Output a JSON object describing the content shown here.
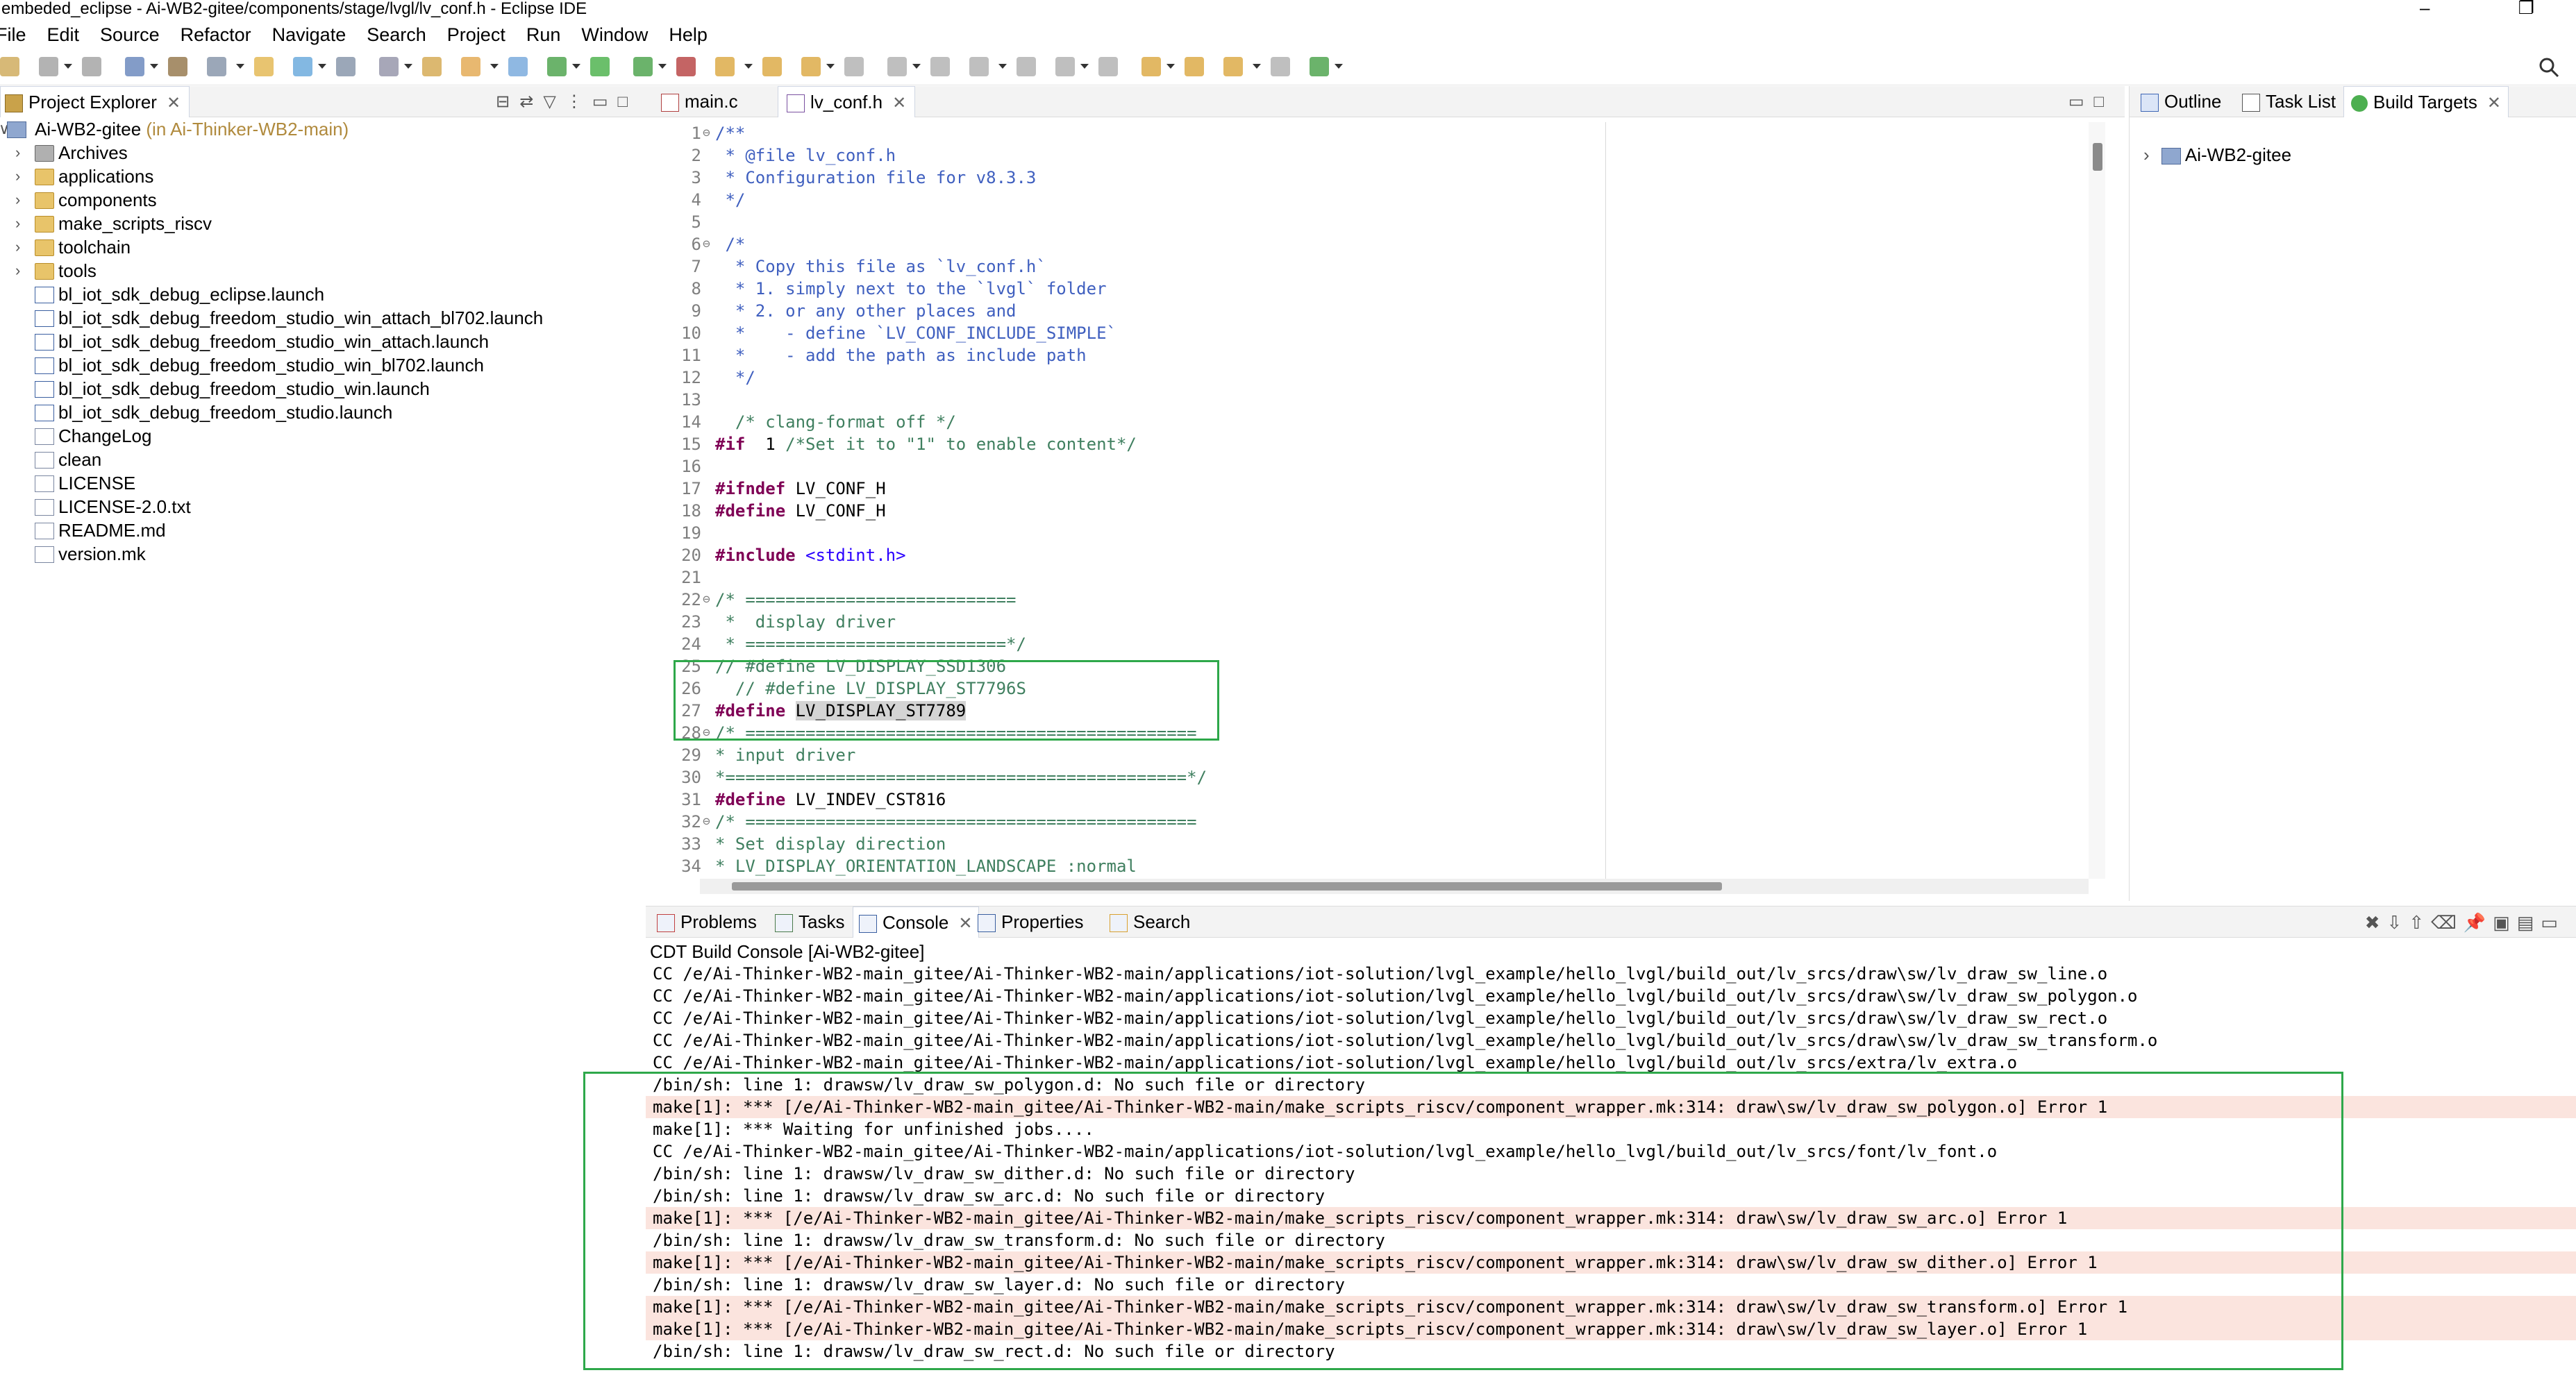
{
  "window": {
    "title": "embeded_eclipse - Ai-WB2-gitee/components/stage/lvgl/lv_conf.h - Eclipse IDE",
    "controls": "–  ❐"
  },
  "menu": [
    "File",
    "Edit",
    "Source",
    "Refactor",
    "Navigate",
    "Search",
    "Project",
    "Run",
    "Window",
    "Help"
  ],
  "explorer": {
    "tab_label": "Project Explorer",
    "root": {
      "name": "Ai-WB2-gitee",
      "suffix": " (in Ai-Thinker-WB2-main)"
    },
    "items": [
      {
        "label": "Archives",
        "kind": "archive",
        "expandable": true
      },
      {
        "label": "applications",
        "kind": "folder",
        "expandable": true
      },
      {
        "label": "components",
        "kind": "folder",
        "expandable": true
      },
      {
        "label": "make_scripts_riscv",
        "kind": "folder",
        "expandable": true
      },
      {
        "label": "toolchain",
        "kind": "folder",
        "expandable": true
      },
      {
        "label": "tools",
        "kind": "folder",
        "expandable": true
      },
      {
        "label": "bl_iot_sdk_debug_eclipse.launch",
        "kind": "launch",
        "expandable": false
      },
      {
        "label": "bl_iot_sdk_debug_freedom_studio_win_attach_bl702.launch",
        "kind": "launch",
        "expandable": false
      },
      {
        "label": "bl_iot_sdk_debug_freedom_studio_win_attach.launch",
        "kind": "launch",
        "expandable": false
      },
      {
        "label": "bl_iot_sdk_debug_freedom_studio_win_bl702.launch",
        "kind": "launch",
        "expandable": false
      },
      {
        "label": "bl_iot_sdk_debug_freedom_studio_win.launch",
        "kind": "launch",
        "expandable": false
      },
      {
        "label": "bl_iot_sdk_debug_freedom_studio.launch",
        "kind": "launch",
        "expandable": false
      },
      {
        "label": "ChangeLog",
        "kind": "file",
        "expandable": false
      },
      {
        "label": "clean",
        "kind": "file",
        "expandable": false
      },
      {
        "label": "LICENSE",
        "kind": "file",
        "expandable": false
      },
      {
        "label": "LICENSE-2.0.txt",
        "kind": "file",
        "expandable": false
      },
      {
        "label": "README.md",
        "kind": "file",
        "expandable": false
      },
      {
        "label": "version.mk",
        "kind": "file",
        "expandable": false
      }
    ]
  },
  "editor": {
    "tabs": [
      {
        "label": "main.c",
        "active": false
      },
      {
        "label": "lv_conf.h",
        "active": true
      }
    ],
    "lines": [
      {
        "n": "1",
        "fold": "⊖",
        "segs": [
          [
            "c-com",
            "/**"
          ]
        ]
      },
      {
        "n": "2",
        "segs": [
          [
            "c-com",
            " * @file lv_conf.h"
          ]
        ]
      },
      {
        "n": "3",
        "segs": [
          [
            "c-com",
            " * Configuration file for v8.3.3"
          ]
        ]
      },
      {
        "n": "4",
        "segs": [
          [
            "c-com",
            " */"
          ]
        ]
      },
      {
        "n": "5",
        "segs": []
      },
      {
        "n": "6",
        "fold": "⊖",
        "segs": [
          [
            "c-com",
            " /*"
          ]
        ]
      },
      {
        "n": "7",
        "segs": [
          [
            "c-com",
            "  * Copy this file as `lv_conf.h`"
          ]
        ]
      },
      {
        "n": "8",
        "segs": [
          [
            "c-com",
            "  * 1. simply next to the `lvgl` folder"
          ]
        ]
      },
      {
        "n": "9",
        "segs": [
          [
            "c-com",
            "  * 2. or any other places and"
          ]
        ]
      },
      {
        "n": "10",
        "segs": [
          [
            "c-com",
            "  *    - define `LV_CONF_INCLUDE_SIMPLE`"
          ]
        ]
      },
      {
        "n": "11",
        "segs": [
          [
            "c-com",
            "  *    - add the path as include path"
          ]
        ]
      },
      {
        "n": "12",
        "segs": [
          [
            "c-com",
            "  */"
          ]
        ]
      },
      {
        "n": "13",
        "segs": []
      },
      {
        "n": "14",
        "segs": [
          [
            "c-grn",
            "  /* clang-format off */"
          ]
        ]
      },
      {
        "n": "15",
        "segs": [
          [
            "c-kw",
            "#if"
          ],
          [
            "",
            "  1 "
          ],
          [
            "c-grn",
            "/*Set it to \"1\" to enable content*/"
          ]
        ]
      },
      {
        "n": "16",
        "segs": []
      },
      {
        "n": "17",
        "segs": [
          [
            "c-kw",
            "#ifndef"
          ],
          [
            "",
            " LV_CONF_H"
          ]
        ]
      },
      {
        "n": "18",
        "segs": [
          [
            "c-kw",
            "#define"
          ],
          [
            "",
            " LV_CONF_H"
          ]
        ]
      },
      {
        "n": "19",
        "segs": []
      },
      {
        "n": "20",
        "segs": [
          [
            "c-kw",
            "#include"
          ],
          [
            "",
            " "
          ],
          [
            "c-str",
            "<stdint.h>"
          ]
        ]
      },
      {
        "n": "21",
        "segs": []
      },
      {
        "n": "22",
        "fold": "⊖",
        "segs": [
          [
            "c-grn",
            "/* ==========================="
          ]
        ]
      },
      {
        "n": "23",
        "segs": [
          [
            "c-grn",
            " *  display driver"
          ]
        ]
      },
      {
        "n": "24",
        "segs": [
          [
            "c-grn",
            " * ==========================*/"
          ]
        ]
      },
      {
        "n": "25",
        "segs": [
          [
            "c-grn",
            "// #define LV_DISPLAY_SSD1306"
          ]
        ]
      },
      {
        "n": "26",
        "segs": [
          [
            "c-grn",
            "  // #define LV_DISPLAY_ST7796S"
          ]
        ]
      },
      {
        "n": "27",
        "segs": [
          [
            "c-kw",
            "#define"
          ],
          [
            "",
            " "
          ],
          [
            "c-sel",
            "LV_DISPLAY_ST7789"
          ]
        ]
      },
      {
        "n": "28",
        "fold": "⊖",
        "segs": [
          [
            "c-grn",
            "/* ============================================="
          ]
        ]
      },
      {
        "n": "29",
        "segs": [
          [
            "c-grn",
            "* input driver"
          ]
        ]
      },
      {
        "n": "30",
        "segs": [
          [
            "c-grn",
            "*==============================================*/"
          ]
        ]
      },
      {
        "n": "31",
        "segs": [
          [
            "c-kw",
            "#define"
          ],
          [
            "",
            " LV_INDEV_CST816"
          ]
        ]
      },
      {
        "n": "32",
        "fold": "⊖",
        "segs": [
          [
            "c-grn",
            "/* ============================================="
          ]
        ]
      },
      {
        "n": "33",
        "segs": [
          [
            "c-grn",
            "* Set display direction"
          ]
        ]
      },
      {
        "n": "34",
        "segs": [
          [
            "c-grn",
            "* LV_DISPLAY_ORIENTATION_LANDSCAPE :normal"
          ]
        ]
      }
    ]
  },
  "outline": {
    "tabs": [
      {
        "label": "Outline"
      },
      {
        "label": "Task List"
      },
      {
        "label": "Build Targets"
      }
    ],
    "tree": [
      {
        "label": "Ai-WB2-gitee"
      }
    ]
  },
  "console": {
    "tabs": [
      {
        "label": "Problems"
      },
      {
        "label": "Tasks"
      },
      {
        "label": "Console",
        "active": true
      },
      {
        "label": "Properties"
      },
      {
        "label": "Search"
      }
    ],
    "title": "CDT Build Console [Ai-WB2-gitee]",
    "lines": [
      {
        "t": "CC /e/Ai-Thinker-WB2-main_gitee/Ai-Thinker-WB2-main/applications/iot-solution/lvgl_example/hello_lvgl/build_out/lv_srcs/draw\\sw/lv_draw_sw_line.o",
        "err": false
      },
      {
        "t": "CC /e/Ai-Thinker-WB2-main_gitee/Ai-Thinker-WB2-main/applications/iot-solution/lvgl_example/hello_lvgl/build_out/lv_srcs/draw\\sw/lv_draw_sw_polygon.o",
        "err": false
      },
      {
        "t": "CC /e/Ai-Thinker-WB2-main_gitee/Ai-Thinker-WB2-main/applications/iot-solution/lvgl_example/hello_lvgl/build_out/lv_srcs/draw\\sw/lv_draw_sw_rect.o",
        "err": false
      },
      {
        "t": "CC /e/Ai-Thinker-WB2-main_gitee/Ai-Thinker-WB2-main/applications/iot-solution/lvgl_example/hello_lvgl/build_out/lv_srcs/draw\\sw/lv_draw_sw_transform.o",
        "err": false
      },
      {
        "t": "CC /e/Ai-Thinker-WB2-main_gitee/Ai-Thinker-WB2-main/applications/iot-solution/lvgl_example/hello_lvgl/build_out/lv_srcs/extra/lv_extra.o",
        "err": false
      },
      {
        "t": "/bin/sh: line 1: drawsw/lv_draw_sw_polygon.d: No such file or directory",
        "err": false
      },
      {
        "t": "make[1]: *** [/e/Ai-Thinker-WB2-main_gitee/Ai-Thinker-WB2-main/make_scripts_riscv/component_wrapper.mk:314: draw\\sw/lv_draw_sw_polygon.o] Error 1",
        "err": true
      },
      {
        "t": "make[1]: *** Waiting for unfinished jobs....",
        "err": false
      },
      {
        "t": "CC /e/Ai-Thinker-WB2-main_gitee/Ai-Thinker-WB2-main/applications/iot-solution/lvgl_example/hello_lvgl/build_out/lv_srcs/font/lv_font.o",
        "err": false
      },
      {
        "t": "/bin/sh: line 1: drawsw/lv_draw_sw_dither.d: No such file or directory",
        "err": false
      },
      {
        "t": "/bin/sh: line 1: drawsw/lv_draw_sw_arc.d: No such file or directory",
        "err": false
      },
      {
        "t": "make[1]: *** [/e/Ai-Thinker-WB2-main_gitee/Ai-Thinker-WB2-main/make_scripts_riscv/component_wrapper.mk:314: draw\\sw/lv_draw_sw_arc.o] Error 1",
        "err": true
      },
      {
        "t": "/bin/sh: line 1: drawsw/lv_draw_sw_transform.d: No such file or directory",
        "err": false
      },
      {
        "t": "make[1]: *** [/e/Ai-Thinker-WB2-main_gitee/Ai-Thinker-WB2-main/make_scripts_riscv/component_wrapper.mk:314: draw\\sw/lv_draw_sw_dither.o] Error 1",
        "err": true
      },
      {
        "t": "/bin/sh: line 1: drawsw/lv_draw_sw_layer.d: No such file or directory",
        "err": false
      },
      {
        "t": "make[1]: *** [/e/Ai-Thinker-WB2-main_gitee/Ai-Thinker-WB2-main/make_scripts_riscv/component_wrapper.mk:314: draw\\sw/lv_draw_sw_transform.o] Error 1",
        "err": true
      },
      {
        "t": "make[1]: *** [/e/Ai-Thinker-WB2-main_gitee/Ai-Thinker-WB2-main/make_scripts_riscv/component_wrapper.mk:314: draw\\sw/lv_draw_sw_layer.o] Error 1",
        "err": true
      },
      {
        "t": "/bin/sh: line 1: drawsw/lv_draw_sw_rect.d: No such file or directory",
        "err": false
      }
    ]
  },
  "colors": {
    "highlight_box": "#2ea84a",
    "error_row": "#fbe4de",
    "keyword": "#7f0055",
    "comment_doc": "#3f5fbf",
    "comment": "#3f7f5f"
  }
}
